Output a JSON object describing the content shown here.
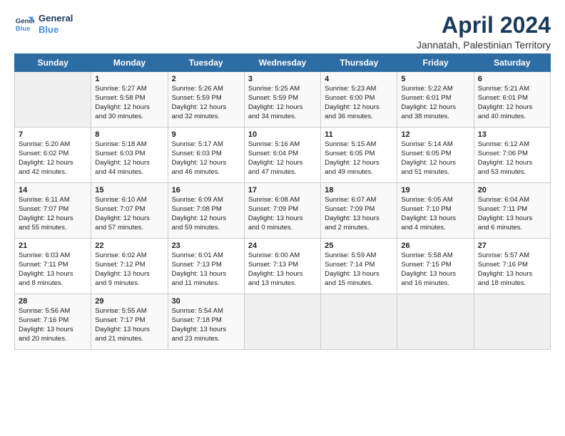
{
  "logo": {
    "line1": "General",
    "line2": "Blue"
  },
  "title": "April 2024",
  "subtitle": "Jannatah, Palestinian Territory",
  "days_header": [
    "Sunday",
    "Monday",
    "Tuesday",
    "Wednesday",
    "Thursday",
    "Friday",
    "Saturday"
  ],
  "weeks": [
    [
      {
        "day": "",
        "content": ""
      },
      {
        "day": "1",
        "content": "Sunrise: 5:27 AM\nSunset: 5:58 PM\nDaylight: 12 hours\nand 30 minutes."
      },
      {
        "day": "2",
        "content": "Sunrise: 5:26 AM\nSunset: 5:59 PM\nDaylight: 12 hours\nand 32 minutes."
      },
      {
        "day": "3",
        "content": "Sunrise: 5:25 AM\nSunset: 5:59 PM\nDaylight: 12 hours\nand 34 minutes."
      },
      {
        "day": "4",
        "content": "Sunrise: 5:23 AM\nSunset: 6:00 PM\nDaylight: 12 hours\nand 36 minutes."
      },
      {
        "day": "5",
        "content": "Sunrise: 5:22 AM\nSunset: 6:01 PM\nDaylight: 12 hours\nand 38 minutes."
      },
      {
        "day": "6",
        "content": "Sunrise: 5:21 AM\nSunset: 6:01 PM\nDaylight: 12 hours\nand 40 minutes."
      }
    ],
    [
      {
        "day": "7",
        "content": "Sunrise: 5:20 AM\nSunset: 6:02 PM\nDaylight: 12 hours\nand 42 minutes."
      },
      {
        "day": "8",
        "content": "Sunrise: 5:18 AM\nSunset: 6:03 PM\nDaylight: 12 hours\nand 44 minutes."
      },
      {
        "day": "9",
        "content": "Sunrise: 5:17 AM\nSunset: 6:03 PM\nDaylight: 12 hours\nand 46 minutes."
      },
      {
        "day": "10",
        "content": "Sunrise: 5:16 AM\nSunset: 6:04 PM\nDaylight: 12 hours\nand 47 minutes."
      },
      {
        "day": "11",
        "content": "Sunrise: 5:15 AM\nSunset: 6:05 PM\nDaylight: 12 hours\nand 49 minutes."
      },
      {
        "day": "12",
        "content": "Sunrise: 5:14 AM\nSunset: 6:05 PM\nDaylight: 12 hours\nand 51 minutes."
      },
      {
        "day": "13",
        "content": "Sunrise: 6:12 AM\nSunset: 7:06 PM\nDaylight: 12 hours\nand 53 minutes."
      }
    ],
    [
      {
        "day": "14",
        "content": "Sunrise: 6:11 AM\nSunset: 7:07 PM\nDaylight: 12 hours\nand 55 minutes."
      },
      {
        "day": "15",
        "content": "Sunrise: 6:10 AM\nSunset: 7:07 PM\nDaylight: 12 hours\nand 57 minutes."
      },
      {
        "day": "16",
        "content": "Sunrise: 6:09 AM\nSunset: 7:08 PM\nDaylight: 12 hours\nand 59 minutes."
      },
      {
        "day": "17",
        "content": "Sunrise: 6:08 AM\nSunset: 7:09 PM\nDaylight: 13 hours\nand 0 minutes."
      },
      {
        "day": "18",
        "content": "Sunrise: 6:07 AM\nSunset: 7:09 PM\nDaylight: 13 hours\nand 2 minutes."
      },
      {
        "day": "19",
        "content": "Sunrise: 6:05 AM\nSunset: 7:10 PM\nDaylight: 13 hours\nand 4 minutes."
      },
      {
        "day": "20",
        "content": "Sunrise: 6:04 AM\nSunset: 7:11 PM\nDaylight: 13 hours\nand 6 minutes."
      }
    ],
    [
      {
        "day": "21",
        "content": "Sunrise: 6:03 AM\nSunset: 7:11 PM\nDaylight: 13 hours\nand 8 minutes."
      },
      {
        "day": "22",
        "content": "Sunrise: 6:02 AM\nSunset: 7:12 PM\nDaylight: 13 hours\nand 9 minutes."
      },
      {
        "day": "23",
        "content": "Sunrise: 6:01 AM\nSunset: 7:13 PM\nDaylight: 13 hours\nand 11 minutes."
      },
      {
        "day": "24",
        "content": "Sunrise: 6:00 AM\nSunset: 7:13 PM\nDaylight: 13 hours\nand 13 minutes."
      },
      {
        "day": "25",
        "content": "Sunrise: 5:59 AM\nSunset: 7:14 PM\nDaylight: 13 hours\nand 15 minutes."
      },
      {
        "day": "26",
        "content": "Sunrise: 5:58 AM\nSunset: 7:15 PM\nDaylight: 13 hours\nand 16 minutes."
      },
      {
        "day": "27",
        "content": "Sunrise: 5:57 AM\nSunset: 7:16 PM\nDaylight: 13 hours\nand 18 minutes."
      }
    ],
    [
      {
        "day": "28",
        "content": "Sunrise: 5:56 AM\nSunset: 7:16 PM\nDaylight: 13 hours\nand 20 minutes."
      },
      {
        "day": "29",
        "content": "Sunrise: 5:55 AM\nSunset: 7:17 PM\nDaylight: 13 hours\nand 21 minutes."
      },
      {
        "day": "30",
        "content": "Sunrise: 5:54 AM\nSunset: 7:18 PM\nDaylight: 13 hours\nand 23 minutes."
      },
      {
        "day": "",
        "content": ""
      },
      {
        "day": "",
        "content": ""
      },
      {
        "day": "",
        "content": ""
      },
      {
        "day": "",
        "content": ""
      }
    ]
  ]
}
